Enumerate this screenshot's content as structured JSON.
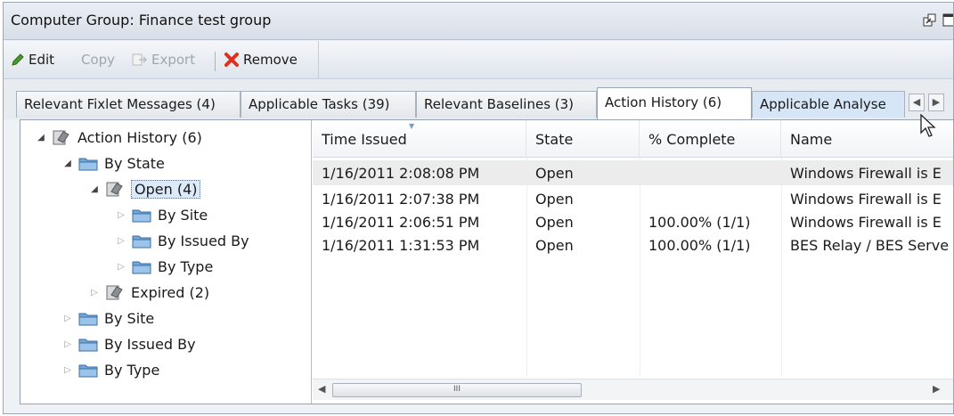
{
  "window": {
    "title": "Computer Group: Finance test group"
  },
  "toolbar": {
    "edit_label": "Edit",
    "copy_label": "Copy",
    "export_label": "Export",
    "remove_label": "Remove"
  },
  "tabs": [
    {
      "label": "Relevant Fixlet Messages (4)",
      "active": false
    },
    {
      "label": "Applicable Tasks (39)",
      "active": false
    },
    {
      "label": "Relevant Baselines (3)",
      "active": false
    },
    {
      "label": "Action History (6)",
      "active": true
    },
    {
      "label": "Applicable Analyse",
      "active": false
    }
  ],
  "tree": {
    "root": "Action History (6)",
    "by_state": "By State",
    "open": "Open (4)",
    "open_by_site": "By Site",
    "open_by_issued_by": "By Issued By",
    "open_by_type": "By Type",
    "expired": "Expired (2)",
    "by_site": "By Site",
    "by_issued_by": "By Issued By",
    "by_type": "By Type"
  },
  "table": {
    "columns": [
      "Time Issued",
      "State",
      "% Complete",
      "Name"
    ],
    "rows": [
      {
        "time": "1/16/2011 2:08:08 PM",
        "state": "Open",
        "complete": "",
        "name": "Windows Firewall is E"
      },
      {
        "time": "1/16/2011 2:07:38 PM",
        "state": "Open",
        "complete": "",
        "name": "Windows Firewall is E"
      },
      {
        "time": "1/16/2011 2:06:51 PM",
        "state": "Open",
        "complete": "100.00% (1/1)",
        "name": "Windows Firewall is E"
      },
      {
        "time": "1/16/2011 1:31:53 PM",
        "state": "Open",
        "complete": "100.00% (1/1)",
        "name": "BES Relay / BES Serve"
      }
    ]
  },
  "scrollbar": {
    "thumb_grip": "III"
  },
  "colors": {
    "remove_red": "#e0301e",
    "edit_green": "#4a9a2a",
    "folder_blue": "#6fa8dc",
    "active_tab": "#ffffff"
  },
  "icons": [
    "pencil-icon",
    "copy-icon",
    "export-icon",
    "red-x-icon",
    "restore-icon",
    "maximize-icon",
    "action-icon",
    "folder-icon",
    "mouse-cursor-icon"
  ]
}
